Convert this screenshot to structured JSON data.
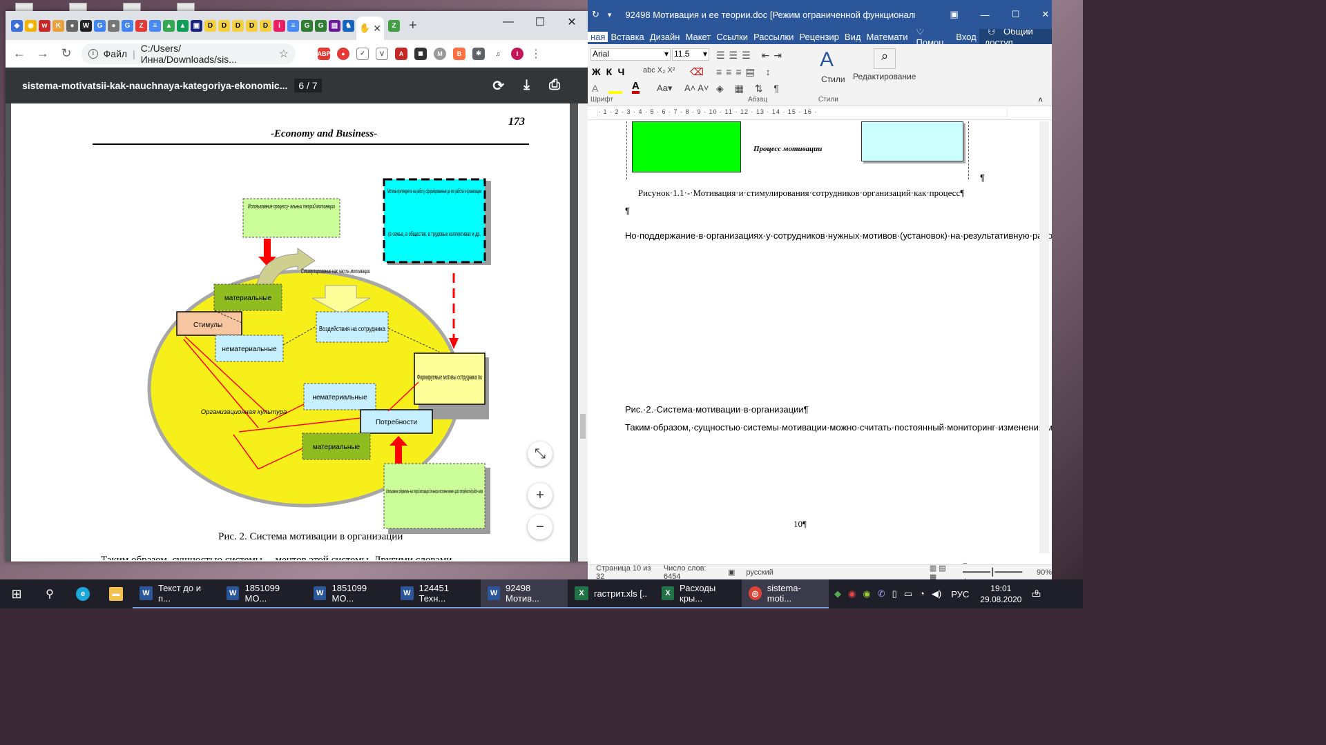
{
  "chrome": {
    "address": "C:/Users/Инна/Downloads/sis...",
    "file_label": "Файл",
    "pdf_title": "sistema-motivatsii-kak-nauchnaya-kategoriya-ekonomic...",
    "page_counter": "6 / 7",
    "page_number": "173",
    "journal": "-Economy and Business-",
    "diagram": {
      "usage_process": "Использование процессу- альных теорий мотивации",
      "motives_box": "Мотивы претендента на работу, сформированные до его работы в организации",
      "motives_box2": "(в семье, в обществе, в трудовых коллективах и др.",
      "stimulation": "Стимулирование как часть мотивации",
      "material1": "материальные",
      "stimuli": "Стимулы",
      "nonmaterial1": "нематериальные",
      "impact": "Воздействия на сотрудника",
      "formed": "Формируемые мотивы сотрудника по",
      "nonmaterial2": "нематериальные",
      "culture": "Организационная культура",
      "needs": "Потребности",
      "material2": "материальные",
      "usage_content": "Использование содержатель- ных теорий мотивации для анализа постоянно меняю- щихся потребностей работ- ников"
    },
    "caption": "Рис. 2. Система мотивации в организации",
    "bottom_text": "Таким образом, сущностью системы ... ментов этой системы. Другими словами"
  },
  "word": {
    "title": "92498 Мотивация и ее теории.doc [Режим ограниченной функциональн...",
    "tabs": [
      "ная",
      "Вставка",
      "Дизайн",
      "Макет",
      "Ссылки",
      "Рассылки",
      "Рецензир",
      "Вид",
      "Математи",
      "Помоц",
      "Вход",
      "Общий доступ"
    ],
    "font": "Arial",
    "size": "11,5",
    "groups": {
      "font": "Шрифт",
      "paragraph": "Абзац",
      "styles": "Стили",
      "styles_btn": "Стили",
      "editing": "Редактирование"
    },
    "process_label": "Процесс мотивации",
    "fig_caption": "Рисунок·1.1·-·Мотивация·и·стимулирования·сотрудников·организаций·как·процесс¶",
    "para1": "Но·поддержание·в·организациях·у·сотрудников·нужных·мотивов·(установок)·на·результативную·работу·длительное·время·требует·системного·подхода.·В·науке·под·«системой»·понимается·множество·закономерно·связанных·друг·с·другом·элементов·(предметов,·явлений,·взглядов,·знаний),·представляющее·собой·определенное·целостное·образование,·единство.·Например,·в·Советском·энциклопедическом·словаре·записано,·что·понятие·«система»·определяется·как·«множество·элементов,·находящихся·в·отношениях·и·связях·друг·с·другом,·образующих·определенную·целостность,·единство».·При·этом·основными·элементами·этой·системы·остаются·мотивы·сотрудников·на·результативную·работу,·их·материальные·и·нематериальные·потребности,·которые·с·приобретением·опыта·с·возрастом·и·др.·периодически·меняются,·а·также·необходимые·материальные·и·нематериальные·стимулы,·которые·должны·удовлетворять·потребности·сотрудников·организации·(рис.·1.2).·Однако·с·позиций·системного·подхода·процесс·мотивации·приобретает·циклический·характер,·когда·на·основе·мониторинга·мотивов·и·потребностей·сотрудников·организаций·своевременно·вносятся·коррективы·в·стимулирование·их·деятельности.¶",
    "fig2": "Рис.·2.·Система·мотивации·в·организации¶",
    "para2": "Таким·образом,·сущностью·системы·мотивации·можно·считать·постоянный·мониторинг·изменения·материальных·и·нематериальных·потребностей·сотрудников·организации,·использование·соответствующих·стимулов·для·удовлетворения·этих·потребностей·в·целях·формирования·у·них·устойчивых·установок·на·результативную·работу·на·основе·сложившейся·в·организации·организационной·культуры.·При·этом,·говоря·об·эффективности·системы·мотивации,·нужно·четко·понимать¶",
    "page_num": "10¶",
    "status": {
      "page": "Страница 10 из 32",
      "words": "Число слов: 6454",
      "lang": "русский",
      "zoom": "90%"
    }
  },
  "taskbar": {
    "items": [
      {
        "label": "Текст до и п...",
        "kind": "W"
      },
      {
        "label": "1851099 МО...",
        "kind": "W"
      },
      {
        "label": "1851099 МО...",
        "kind": "W"
      },
      {
        "label": "124451 Техн...",
        "kind": "W"
      },
      {
        "label": "92498 Мотив...",
        "kind": "W"
      },
      {
        "label": "гастрит.xls [..",
        "kind": "X"
      },
      {
        "label": "Расходы кры...",
        "kind": "X"
      },
      {
        "label": "sistema-moti...",
        "kind": "C"
      }
    ],
    "lang": "РУС",
    "time": "19:01",
    "date": "29.08.2020",
    "notif": "9"
  }
}
